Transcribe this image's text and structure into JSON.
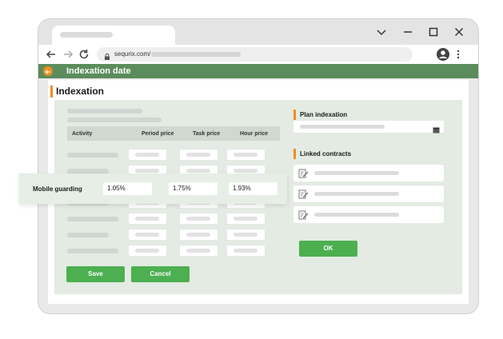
{
  "browser": {
    "url": "sequrix.com/"
  },
  "app": {
    "header_title": "Indexation date",
    "page_title": "Indexation"
  },
  "table": {
    "columns": [
      "Activity",
      "Period price",
      "Task price",
      "Hour price"
    ]
  },
  "buttons": {
    "save": "Save",
    "cancel": "Cancel",
    "ok": "OK"
  },
  "plan": {
    "title": "Plan indexation"
  },
  "contracts": {
    "title": "Linked contracts"
  },
  "popup": {
    "activity": "Mobile guarding",
    "period_price": "1.05%",
    "task_price": "1.75%",
    "hour_price": "1.93%"
  },
  "colors": {
    "header_green": "#5b8c5b",
    "accent_orange": "#f28c1d",
    "button_green": "#4caf50",
    "panel": "#e3ebe3"
  },
  "icons": [
    "chevron-down-icon",
    "minimize-icon",
    "maximize-icon",
    "close-icon",
    "back-arrow-icon",
    "forward-arrow-icon",
    "reload-icon",
    "lock-icon",
    "account-icon",
    "more-vert-icon",
    "calendar-icon",
    "edit-document-icon"
  ]
}
